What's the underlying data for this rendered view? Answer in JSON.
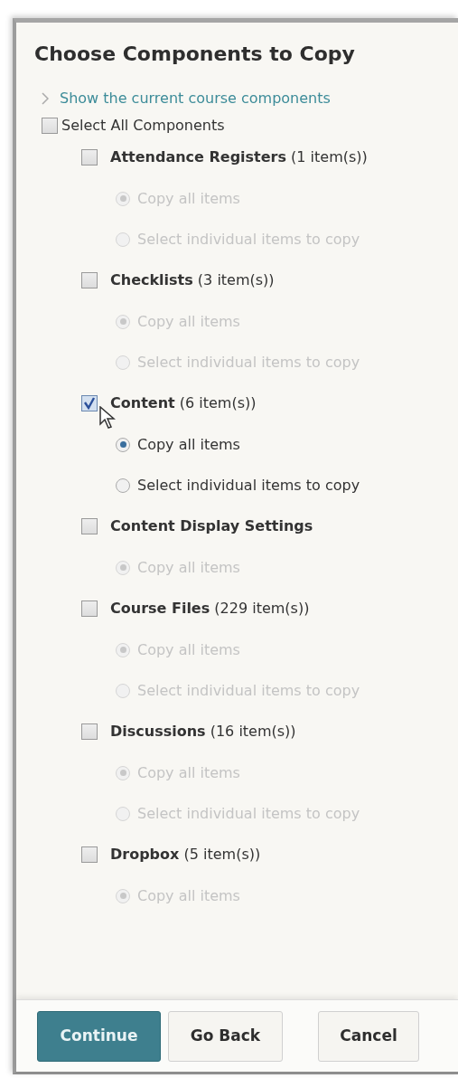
{
  "title": "Choose Components to Copy",
  "toggle_link": {
    "label": "Show the current course components",
    "expanded": false
  },
  "select_all": {
    "label": "Select All Components",
    "checked": false
  },
  "components": [
    {
      "name": "Attendance Registers",
      "count": "(1 item(s))",
      "checked": false,
      "options": [
        {
          "label": "Copy all items",
          "selected": true
        },
        {
          "label": "Select individual items to copy",
          "selected": false
        }
      ]
    },
    {
      "name": "Checklists",
      "count": "(3 item(s))",
      "checked": false,
      "options": [
        {
          "label": "Copy all items",
          "selected": true
        },
        {
          "label": "Select individual items to copy",
          "selected": false
        }
      ]
    },
    {
      "name": "Content",
      "count": "(6 item(s))",
      "checked": true,
      "options": [
        {
          "label": "Copy all items",
          "selected": true
        },
        {
          "label": "Select individual items to copy",
          "selected": false
        }
      ]
    },
    {
      "name": "Content Display Settings",
      "checked": false,
      "options": [
        {
          "label": "Copy all items",
          "selected": true
        }
      ]
    },
    {
      "name": "Course Files",
      "count": "(229 item(s))",
      "checked": false,
      "options": [
        {
          "label": "Copy all items",
          "selected": true
        },
        {
          "label": "Select individual items to copy",
          "selected": false
        }
      ]
    },
    {
      "name": "Discussions",
      "count": "(16 item(s))",
      "checked": false,
      "options": [
        {
          "label": "Copy all items",
          "selected": true
        },
        {
          "label": "Select individual items to copy",
          "selected": false
        }
      ]
    },
    {
      "name": "Dropbox",
      "count": "(5 item(s))",
      "checked": false,
      "options": [
        {
          "label": "Copy all items",
          "selected": true
        }
      ]
    }
  ],
  "buttons": [
    {
      "label": "Continue",
      "kind": "primary"
    },
    {
      "label": "Go Back",
      "kind": "secondary"
    },
    {
      "label": "Cancel",
      "kind": "secondary"
    }
  ]
}
